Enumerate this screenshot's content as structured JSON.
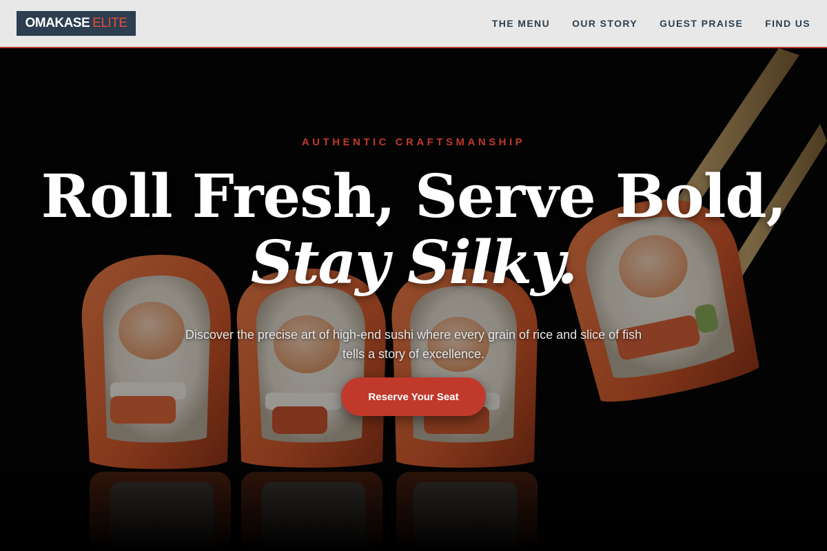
{
  "header": {
    "logo_primary": "OMAKASE",
    "logo_accent": "ELITE",
    "nav": [
      {
        "label": "THE MENU"
      },
      {
        "label": "OUR STORY"
      },
      {
        "label": "GUEST PRAISE"
      },
      {
        "label": "FIND US"
      }
    ]
  },
  "hero": {
    "eyebrow": "AUTHENTIC CRAFTSMANSHIP",
    "headline_line1": "Roll Fresh, Serve Bold,",
    "headline_line2": "Stay Silky.",
    "subtitle": "Discover the precise art of high-end sushi where every grain of rice and slice of fish tells a story of excellence.",
    "cta_label": "Reserve Your Seat"
  },
  "colors": {
    "accent": "#c0392b",
    "logo_bg": "#2c3e50",
    "header_bg": "#e8e8e8",
    "nav_text": "#2c3e50"
  }
}
